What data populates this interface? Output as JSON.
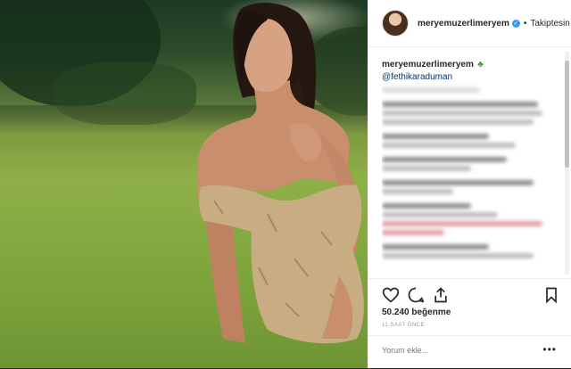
{
  "post": {
    "username": "meryemuzerlimeryem",
    "follow_label": "Takiptesin",
    "separator": "•",
    "verified_mark": "✓"
  },
  "caption": {
    "username": "meryemuzerlimeryem",
    "emoji": "♣",
    "mention": "@fethikaraduman"
  },
  "actions": {
    "likes": "50.240 beğenme",
    "timestamp": "11 SAAT ÖNCE"
  },
  "comment_box": {
    "placeholder": "Yorum ekle...",
    "more_label": "•••"
  },
  "icons": [
    "heart-icon",
    "comment-icon",
    "share-icon",
    "bookmark-icon",
    "verified-badge-icon"
  ],
  "colors": {
    "verified": "#3897f0",
    "mention": "#003569",
    "background": "#262626"
  }
}
